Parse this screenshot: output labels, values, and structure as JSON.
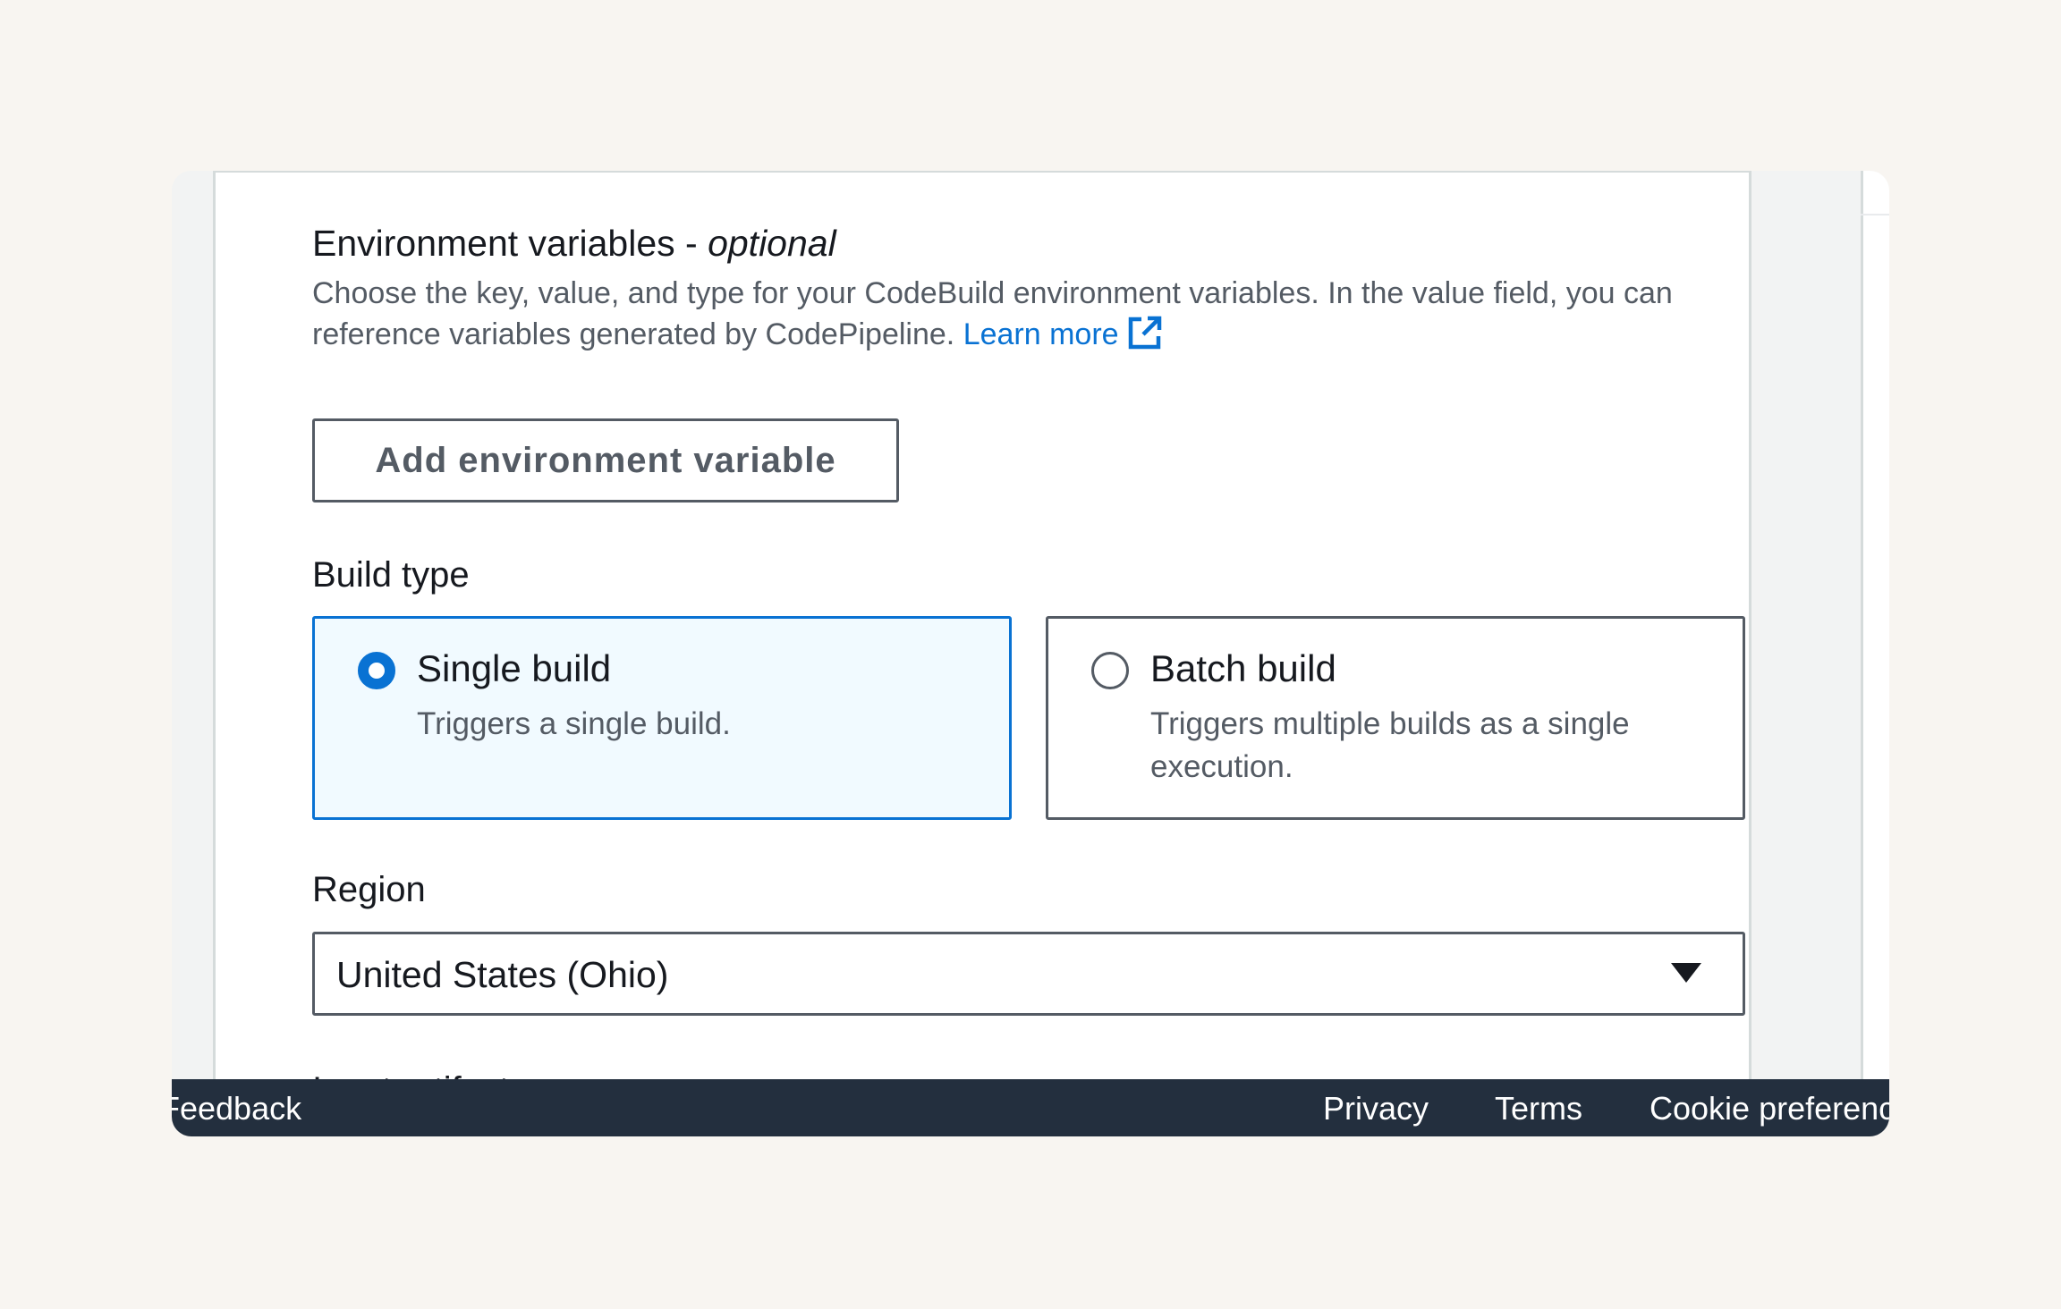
{
  "env_vars": {
    "title": "Environment variables - ",
    "title_optional": "optional",
    "description": "Choose the key, value, and type for your CodeBuild environment variables. In the value field, you can reference variables generated by CodePipeline.",
    "learn_more": "Learn more",
    "add_button": "Add environment variable"
  },
  "build_type": {
    "label": "Build type",
    "options": [
      {
        "title": "Single build",
        "description": "Triggers a single build.",
        "selected": true
      },
      {
        "title": "Batch build",
        "description": "Triggers multiple builds as a single execution.",
        "selected": false
      }
    ]
  },
  "region": {
    "label": "Region",
    "value": "United States (Ohio)"
  },
  "next_section_heading": "Input artifacts",
  "footer": {
    "feedback": "Feedback",
    "privacy": "Privacy",
    "terms": "Terms",
    "cookies": "Cookie preferences"
  },
  "colors": {
    "accent": "#0972d3",
    "footer_bg": "#232f3e",
    "selected_tile_bg": "#f1faff"
  }
}
